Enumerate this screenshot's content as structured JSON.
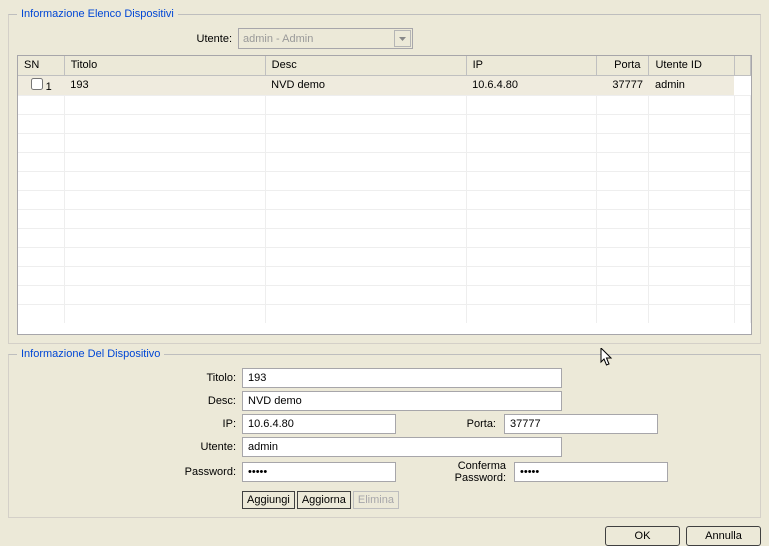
{
  "group1": {
    "title": "Informazione Elenco Dispositivi",
    "user_label": "Utente:",
    "user_value": "admin - Admin",
    "columns": {
      "sn": "SN",
      "titolo": "Titolo",
      "desc": "Desc",
      "ip": "IP",
      "porta": "Porta",
      "utenteid": "Utente ID"
    },
    "row": {
      "sn": "1",
      "titolo": "193",
      "desc": "NVD demo",
      "ip": "10.6.4.80",
      "porta": "37777",
      "utenteid": "admin"
    }
  },
  "group2": {
    "title": "Informazione Del Dispositivo",
    "labels": {
      "titolo": "Titolo:",
      "desc": "Desc:",
      "ip": "IP:",
      "porta": "Porta:",
      "utente": "Utente:",
      "password": "Password:",
      "conferma": "Conferma Password:"
    },
    "values": {
      "titolo": "193",
      "desc": "NVD demo",
      "ip": "10.6.4.80",
      "porta": "37777",
      "utente": "admin",
      "password": "•••••",
      "conferma": "•••••"
    },
    "buttons": {
      "add": "Aggiungi",
      "update": "Aggiorna",
      "delete": "Elimina"
    }
  },
  "footer": {
    "ok": "OK",
    "cancel": "Annulla"
  }
}
